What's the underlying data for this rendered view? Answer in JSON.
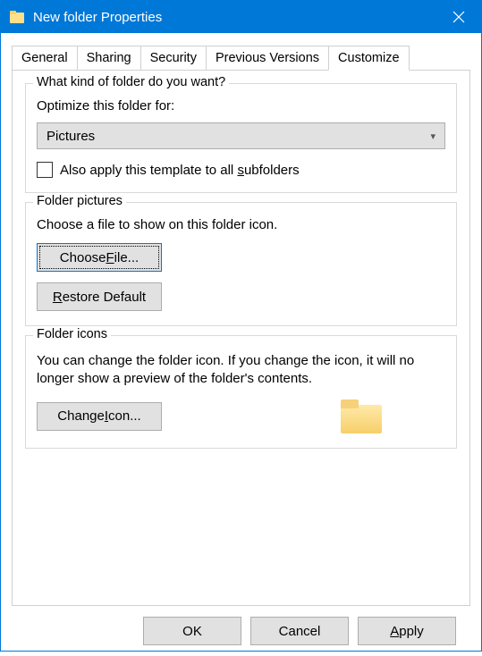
{
  "window": {
    "title": "New folder Properties"
  },
  "tabs": {
    "items": [
      "General",
      "Sharing",
      "Security",
      "Previous Versions",
      "Customize"
    ],
    "active": 4
  },
  "group_kind": {
    "legend": "What kind of folder do you want?",
    "label": "Optimize this folder for:",
    "select_value": "Pictures",
    "checkbox_pre": "Also apply this template to all ",
    "checkbox_u": "s",
    "checkbox_post": "ubfolders"
  },
  "group_pictures": {
    "legend": "Folder pictures",
    "label": "Choose a file to show on this folder icon.",
    "choose_pre": "Choose ",
    "choose_u": "F",
    "choose_post": "ile...",
    "restore_u": "R",
    "restore_post": "estore Default"
  },
  "group_icons": {
    "legend": "Folder icons",
    "desc": "You can change the folder icon. If you change the icon, it will no longer show a preview of the folder's contents.",
    "change_pre": "Change ",
    "change_u": "I",
    "change_post": "con..."
  },
  "footer": {
    "ok": "OK",
    "cancel": "Cancel",
    "apply_u": "A",
    "apply_post": "pply"
  }
}
